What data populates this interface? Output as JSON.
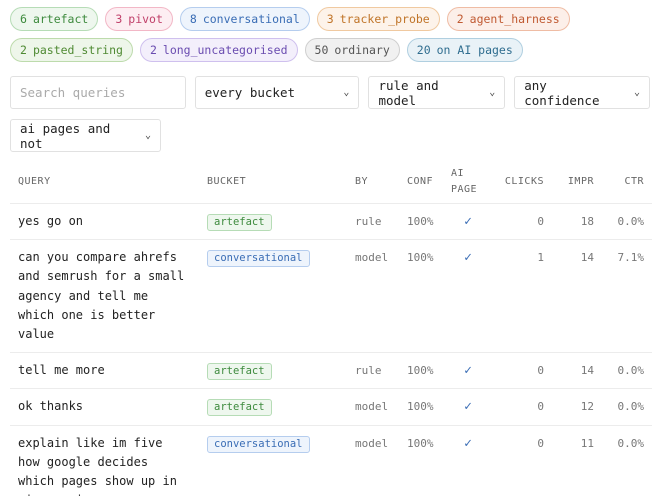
{
  "chips": {
    "row1": [
      {
        "count": "6",
        "label": "artefact",
        "cls": "c-artefact"
      },
      {
        "count": "3",
        "label": "pivot",
        "cls": "c-pivot"
      },
      {
        "count": "8",
        "label": "conversational",
        "cls": "c-conversational"
      },
      {
        "count": "3",
        "label": "tracker_probe",
        "cls": "c-tracker"
      },
      {
        "count": "2",
        "label": "agent_harness",
        "cls": "c-agent"
      }
    ],
    "row2": [
      {
        "count": "2",
        "label": "pasted_string",
        "cls": "c-pasted"
      },
      {
        "count": "2",
        "label": "long_uncategorised",
        "cls": "c-long"
      },
      {
        "count": "50",
        "label": "ordinary",
        "cls": "c-ordinary"
      },
      {
        "count": "20",
        "label": "on AI pages",
        "cls": "c-ai"
      }
    ]
  },
  "filters": {
    "search_placeholder": "Search queries",
    "bucket": "every bucket",
    "by": "rule and model",
    "confidence": "any confidence",
    "ai_pages": "ai pages and not"
  },
  "table": {
    "headers": {
      "query": "QUERY",
      "bucket": "BUCKET",
      "by": "BY",
      "conf": "CONF",
      "ai_page": "AI PAGE",
      "clicks": "CLICKS",
      "impr": "IMPR",
      "ctr": "CTR"
    },
    "rows": [
      {
        "query": "yes go on",
        "bucket": "artefact",
        "by": "rule",
        "conf": "100%",
        "ai": "✓",
        "clicks": "0",
        "impr": "18",
        "ctr": "0.0%"
      },
      {
        "query": "can you compare ahrefs and semrush for a small agency and tell me which one is better value",
        "bucket": "conversational",
        "by": "model",
        "conf": "100%",
        "ai": "✓",
        "clicks": "1",
        "impr": "14",
        "ctr": "7.1%"
      },
      {
        "query": "tell me more",
        "bucket": "artefact",
        "by": "rule",
        "conf": "100%",
        "ai": "✓",
        "clicks": "0",
        "impr": "14",
        "ctr": "0.0%"
      },
      {
        "query": "ok thanks",
        "bucket": "artefact",
        "by": "model",
        "conf": "100%",
        "ai": "✓",
        "clicks": "0",
        "impr": "12",
        "ctr": "0.0%"
      },
      {
        "query": "explain like im five how google decides which pages show up in ai overviews",
        "bucket": "conversational",
        "by": "model",
        "conf": "100%",
        "ai": "✓",
        "clicks": "0",
        "impr": "11",
        "ctr": "0.0%"
      }
    ]
  }
}
